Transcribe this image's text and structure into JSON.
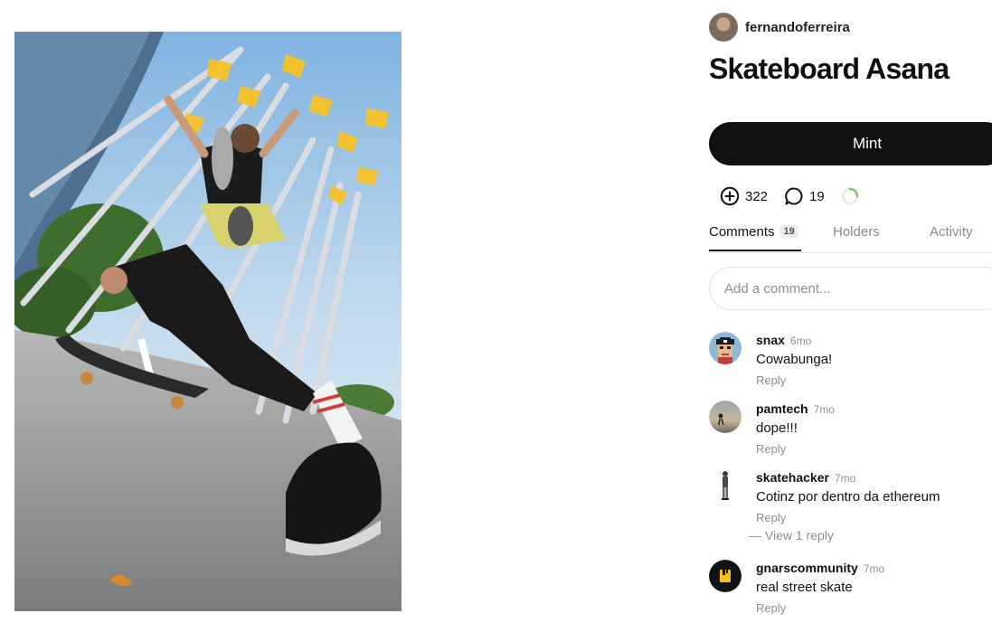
{
  "post": {
    "creator": "fernandoferreira",
    "title": "Skateboard Asana",
    "mint_label": "Mint"
  },
  "stats": {
    "collects": "322",
    "comments": "19"
  },
  "tabs": {
    "comments": "Comments",
    "comments_count": "19",
    "holders": "Holders",
    "activity": "Activity"
  },
  "comment_box": {
    "placeholder": "Add a comment..."
  },
  "comments": [
    {
      "user": "snax",
      "time": "6mo",
      "text": "Cowabunga!",
      "reply": "Reply"
    },
    {
      "user": "pamtech",
      "time": "7mo",
      "text": "dope!!!",
      "reply": "Reply"
    },
    {
      "user": "skatehacker",
      "time": "7mo",
      "text": "Cotinz por dentro da ethereum",
      "reply": "Reply",
      "view_replies": "— View 1 reply"
    },
    {
      "user": "gnarscommunity",
      "time": "7mo",
      "text": "real street skate",
      "reply": "Reply"
    }
  ],
  "colors": {
    "text": "#111111",
    "muted": "#8f8f8f",
    "button_bg": "#111111",
    "spinner": "#7ec86f"
  },
  "icons": {
    "collect": "plus-circle-icon",
    "comments": "speech-bubble-icon",
    "loading": "spinner-icon"
  }
}
